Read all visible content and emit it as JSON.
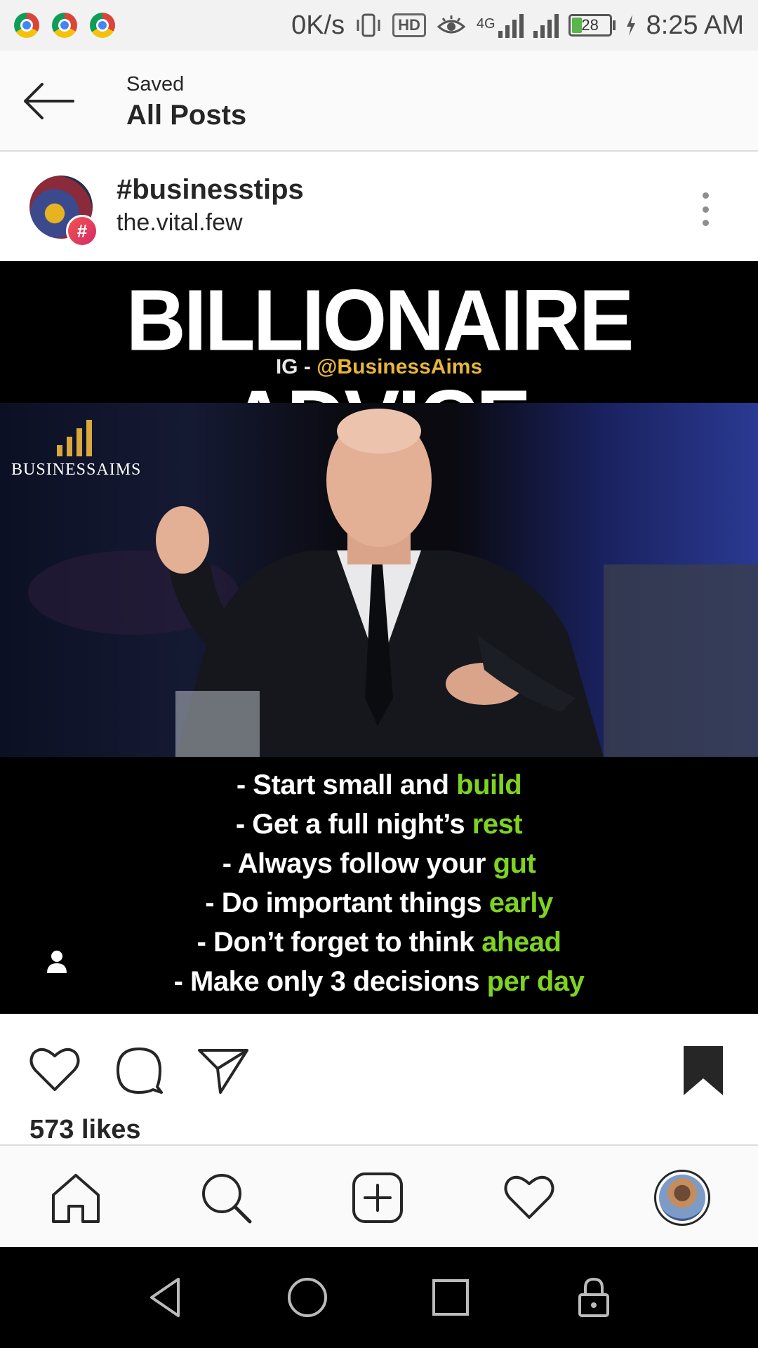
{
  "status_bar": {
    "net_speed": "0K/s",
    "hd_label": "HD",
    "network_label": "4G",
    "battery_level": "28",
    "time": "8:25 AM"
  },
  "header": {
    "subtitle": "Saved",
    "title": "All Posts"
  },
  "post": {
    "hashtag": "#businesstips",
    "username": "the.vital.few",
    "hash_badge": "#",
    "image": {
      "title": "BILLIONAIRE ADVICE",
      "ig_prefix": "IG - ",
      "ig_handle": "@BusinessAims",
      "brand_logo_text": "BUSINESSAIMS",
      "advice": [
        {
          "text": "- Start small and ",
          "highlight": "build"
        },
        {
          "text": "- Get a full night’s ",
          "highlight": "rest"
        },
        {
          "text": "- Always follow your ",
          "highlight": "gut"
        },
        {
          "text": "- Do important things ",
          "highlight": "early"
        },
        {
          "text": "- Don’t forget to think ",
          "highlight": "ahead"
        },
        {
          "text": "- Make only 3 decisions ",
          "highlight": "per day"
        }
      ]
    },
    "likes": "573 likes"
  },
  "icons": {
    "back": "back-arrow-icon",
    "more": "more-options-icon",
    "like": "heart-icon",
    "comment": "comment-icon",
    "share": "paper-plane-icon",
    "save": "bookmark-filled-icon",
    "home": "home-icon",
    "search": "search-icon",
    "add": "add-post-icon",
    "activity": "heart-icon",
    "profile": "profile-avatar"
  },
  "colors": {
    "highlight_green": "#7ed321",
    "handle_gold": "#e8b63a",
    "hashtag_badge": "#e5405e",
    "battery_green": "#5ab54b"
  }
}
